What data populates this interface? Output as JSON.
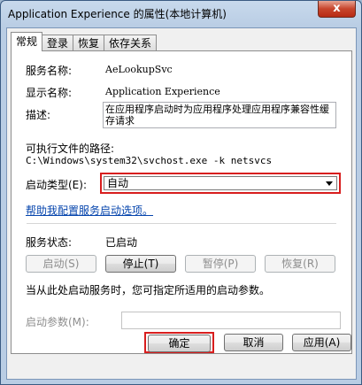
{
  "window": {
    "title": "Application Experience 的属性(本地计算机)",
    "close_label": "x"
  },
  "tabs": [
    {
      "label": "常规"
    },
    {
      "label": "登录"
    },
    {
      "label": "恢复"
    },
    {
      "label": "依存关系"
    }
  ],
  "general": {
    "service_name_label": "服务名称:",
    "service_name_value": "AeLookupSvc",
    "display_name_label": "显示名称:",
    "display_name_value": "Application Experience",
    "description_label": "描述:",
    "description_value": "在应用程序启动时为应用程序处理应用程序兼容性缓存请求",
    "exe_path_label": "可执行文件的路径:",
    "exe_path_value": "C:\\Windows\\system32\\svchost.exe -k netsvcs",
    "startup_type_label": "启动类型(E):",
    "startup_type_value": "自动",
    "help_link": "帮助我配置服务启动选项。",
    "status_label": "服务状态:",
    "status_value": "已启动",
    "buttons": {
      "start": "启动(S)",
      "stop": "停止(T)",
      "pause": "暂停(P)",
      "resume": "恢复(R)"
    },
    "note": "当从此处启动服务时，您可指定所适用的启动参数。",
    "start_params_label": "启动参数(M):",
    "start_params_value": ""
  },
  "footer": {
    "ok": "确定",
    "cancel": "取消",
    "apply": "应用(A)"
  }
}
